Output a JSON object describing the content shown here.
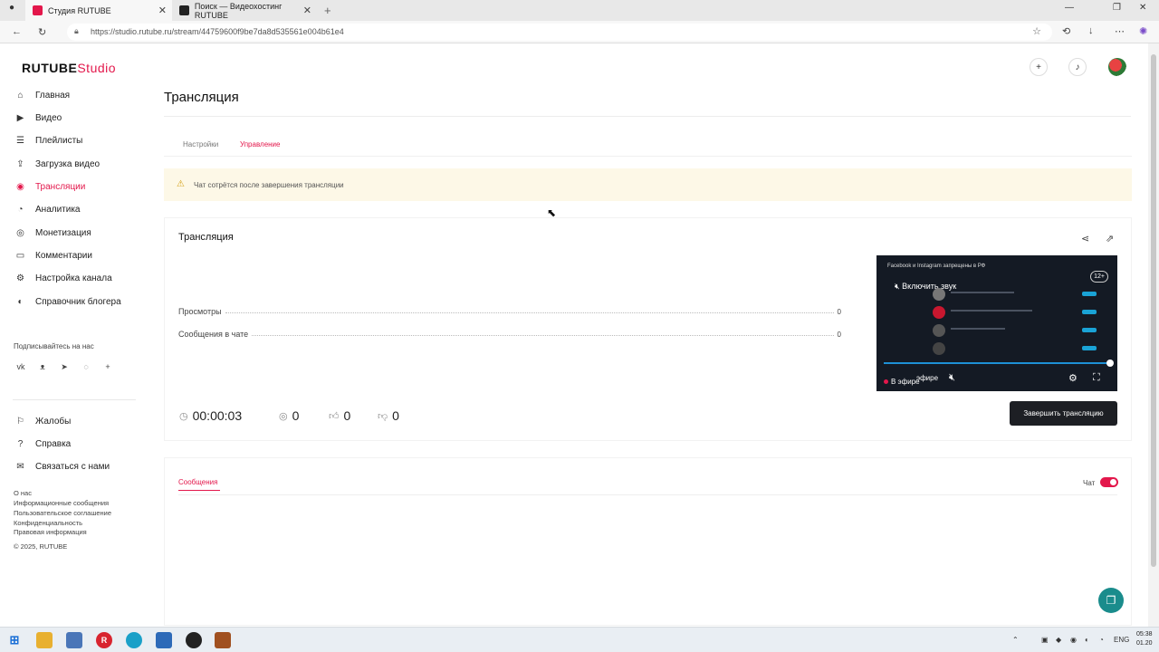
{
  "browser": {
    "tabs": [
      {
        "title": "Студия RUTUBE",
        "active": true
      },
      {
        "title": "Поиск — Видеохостинг RUTUBE",
        "active": false
      }
    ],
    "url": "https://studio.rutube.ru/stream/44759600f9be7da8d535561e004b61e4"
  },
  "app": {
    "logo_main": "RUTUBE",
    "logo_sub": "Studio",
    "brand_color": "#e3174b"
  },
  "sidebar": {
    "items": [
      {
        "label": "Главная",
        "icon": "home-icon"
      },
      {
        "label": "Видео",
        "icon": "video-icon"
      },
      {
        "label": "Плейлисты",
        "icon": "playlist-icon"
      },
      {
        "label": "Загрузка видео",
        "icon": "upload-icon"
      },
      {
        "label": "Трансляции",
        "icon": "broadcast-icon",
        "active": true
      },
      {
        "label": "Аналитика",
        "icon": "analytics-icon"
      },
      {
        "label": "Монетизация",
        "icon": "monetization-icon"
      },
      {
        "label": "Комментарии",
        "icon": "comments-icon"
      },
      {
        "label": "Настройка канала",
        "icon": "gear-icon"
      },
      {
        "label": "Справочник блогера",
        "icon": "book-icon"
      }
    ],
    "subscribe_title": "Подписывайтесь на нас",
    "secondary": [
      {
        "label": "Жалобы",
        "icon": "flag-icon"
      },
      {
        "label": "Справка",
        "icon": "help-icon"
      },
      {
        "label": "Связаться с нами",
        "icon": "mail-icon"
      }
    ],
    "footer_links": [
      "О нас",
      "Информационные сообщения",
      "Пользовательское соглашение",
      "Конфиденциальность",
      "Правовая информация"
    ],
    "copyright": "© 2025, RUTUBE"
  },
  "main": {
    "title": "Трансляция",
    "tabs": [
      {
        "label": "Настройки",
        "active": false
      },
      {
        "label": "Управление",
        "active": true
      }
    ],
    "warning": "Чат сотрётся после завершения трансляции",
    "stream_card": {
      "title": "Трансляция",
      "rows": [
        {
          "label": "Просмотры",
          "value": "0"
        },
        {
          "label": "Сообщения в чате",
          "value": "0"
        }
      ],
      "timer": "00:00:03",
      "viewers": "0",
      "likes": "0",
      "dislikes": "0",
      "end_button": "Завершить трансляцию",
      "player": {
        "notice": "Facebook и Instagram запрещены в РФ",
        "age": "12+",
        "unmute": "Включить звук",
        "live": "В эфире",
        "live_partial": "эфире",
        "progress_fraction": 1.0
      }
    },
    "messages": {
      "tab": "Сообщения",
      "chat_label": "Чат",
      "chat_enabled": true
    }
  },
  "taskbar": {
    "lang": "ENG",
    "time": "05:38",
    "date": "01.20"
  }
}
